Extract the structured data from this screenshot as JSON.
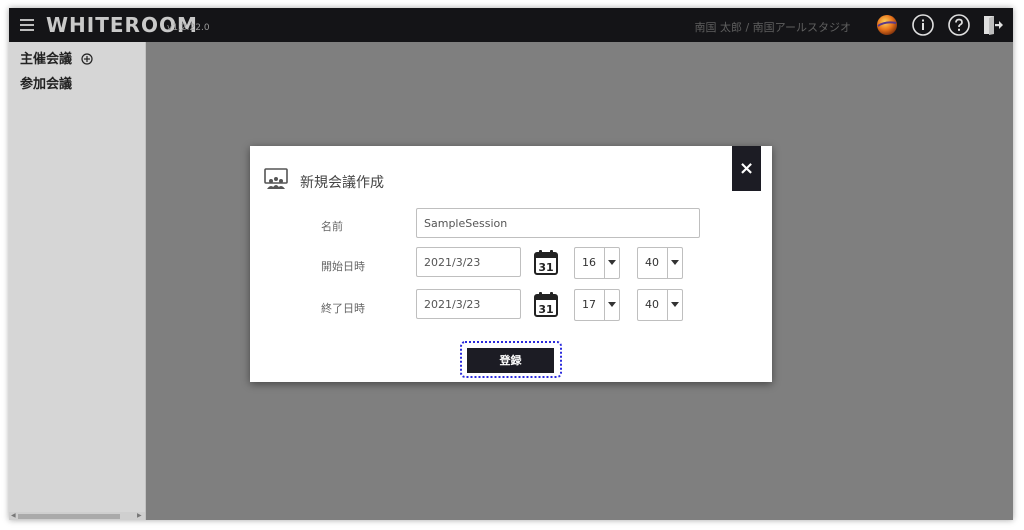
{
  "header": {
    "app_name": "WHITEROOM",
    "version": "v1.2.22.0",
    "user_info": "南国 太郎 / 南国アールスタジオ",
    "icons": [
      "menu-icon",
      "avatar",
      "info-icon",
      "help-icon",
      "logout-icon"
    ]
  },
  "sidebar": {
    "items": [
      {
        "label": "主催会議",
        "icon": "add-circle-icon"
      },
      {
        "label": "参加会議"
      }
    ]
  },
  "dialog": {
    "title": "新規会議作成",
    "title_icon": "meeting-icon",
    "close_label": "×",
    "fields": {
      "name_label": "名前",
      "name_value": "SampleSession",
      "start_label": "開始日時",
      "start_date": "2021/3/23",
      "start_hour": "16",
      "start_minute": "40",
      "end_label": "終了日時",
      "end_date": "2021/3/23",
      "end_hour": "17",
      "end_minute": "40",
      "calendar_day": "31"
    },
    "submit_label": "登録"
  },
  "colors": {
    "topbar": "#141417",
    "overlay": "#7f7f7f",
    "button": "#1c1c24",
    "focus_ring": "#2a2adc"
  }
}
